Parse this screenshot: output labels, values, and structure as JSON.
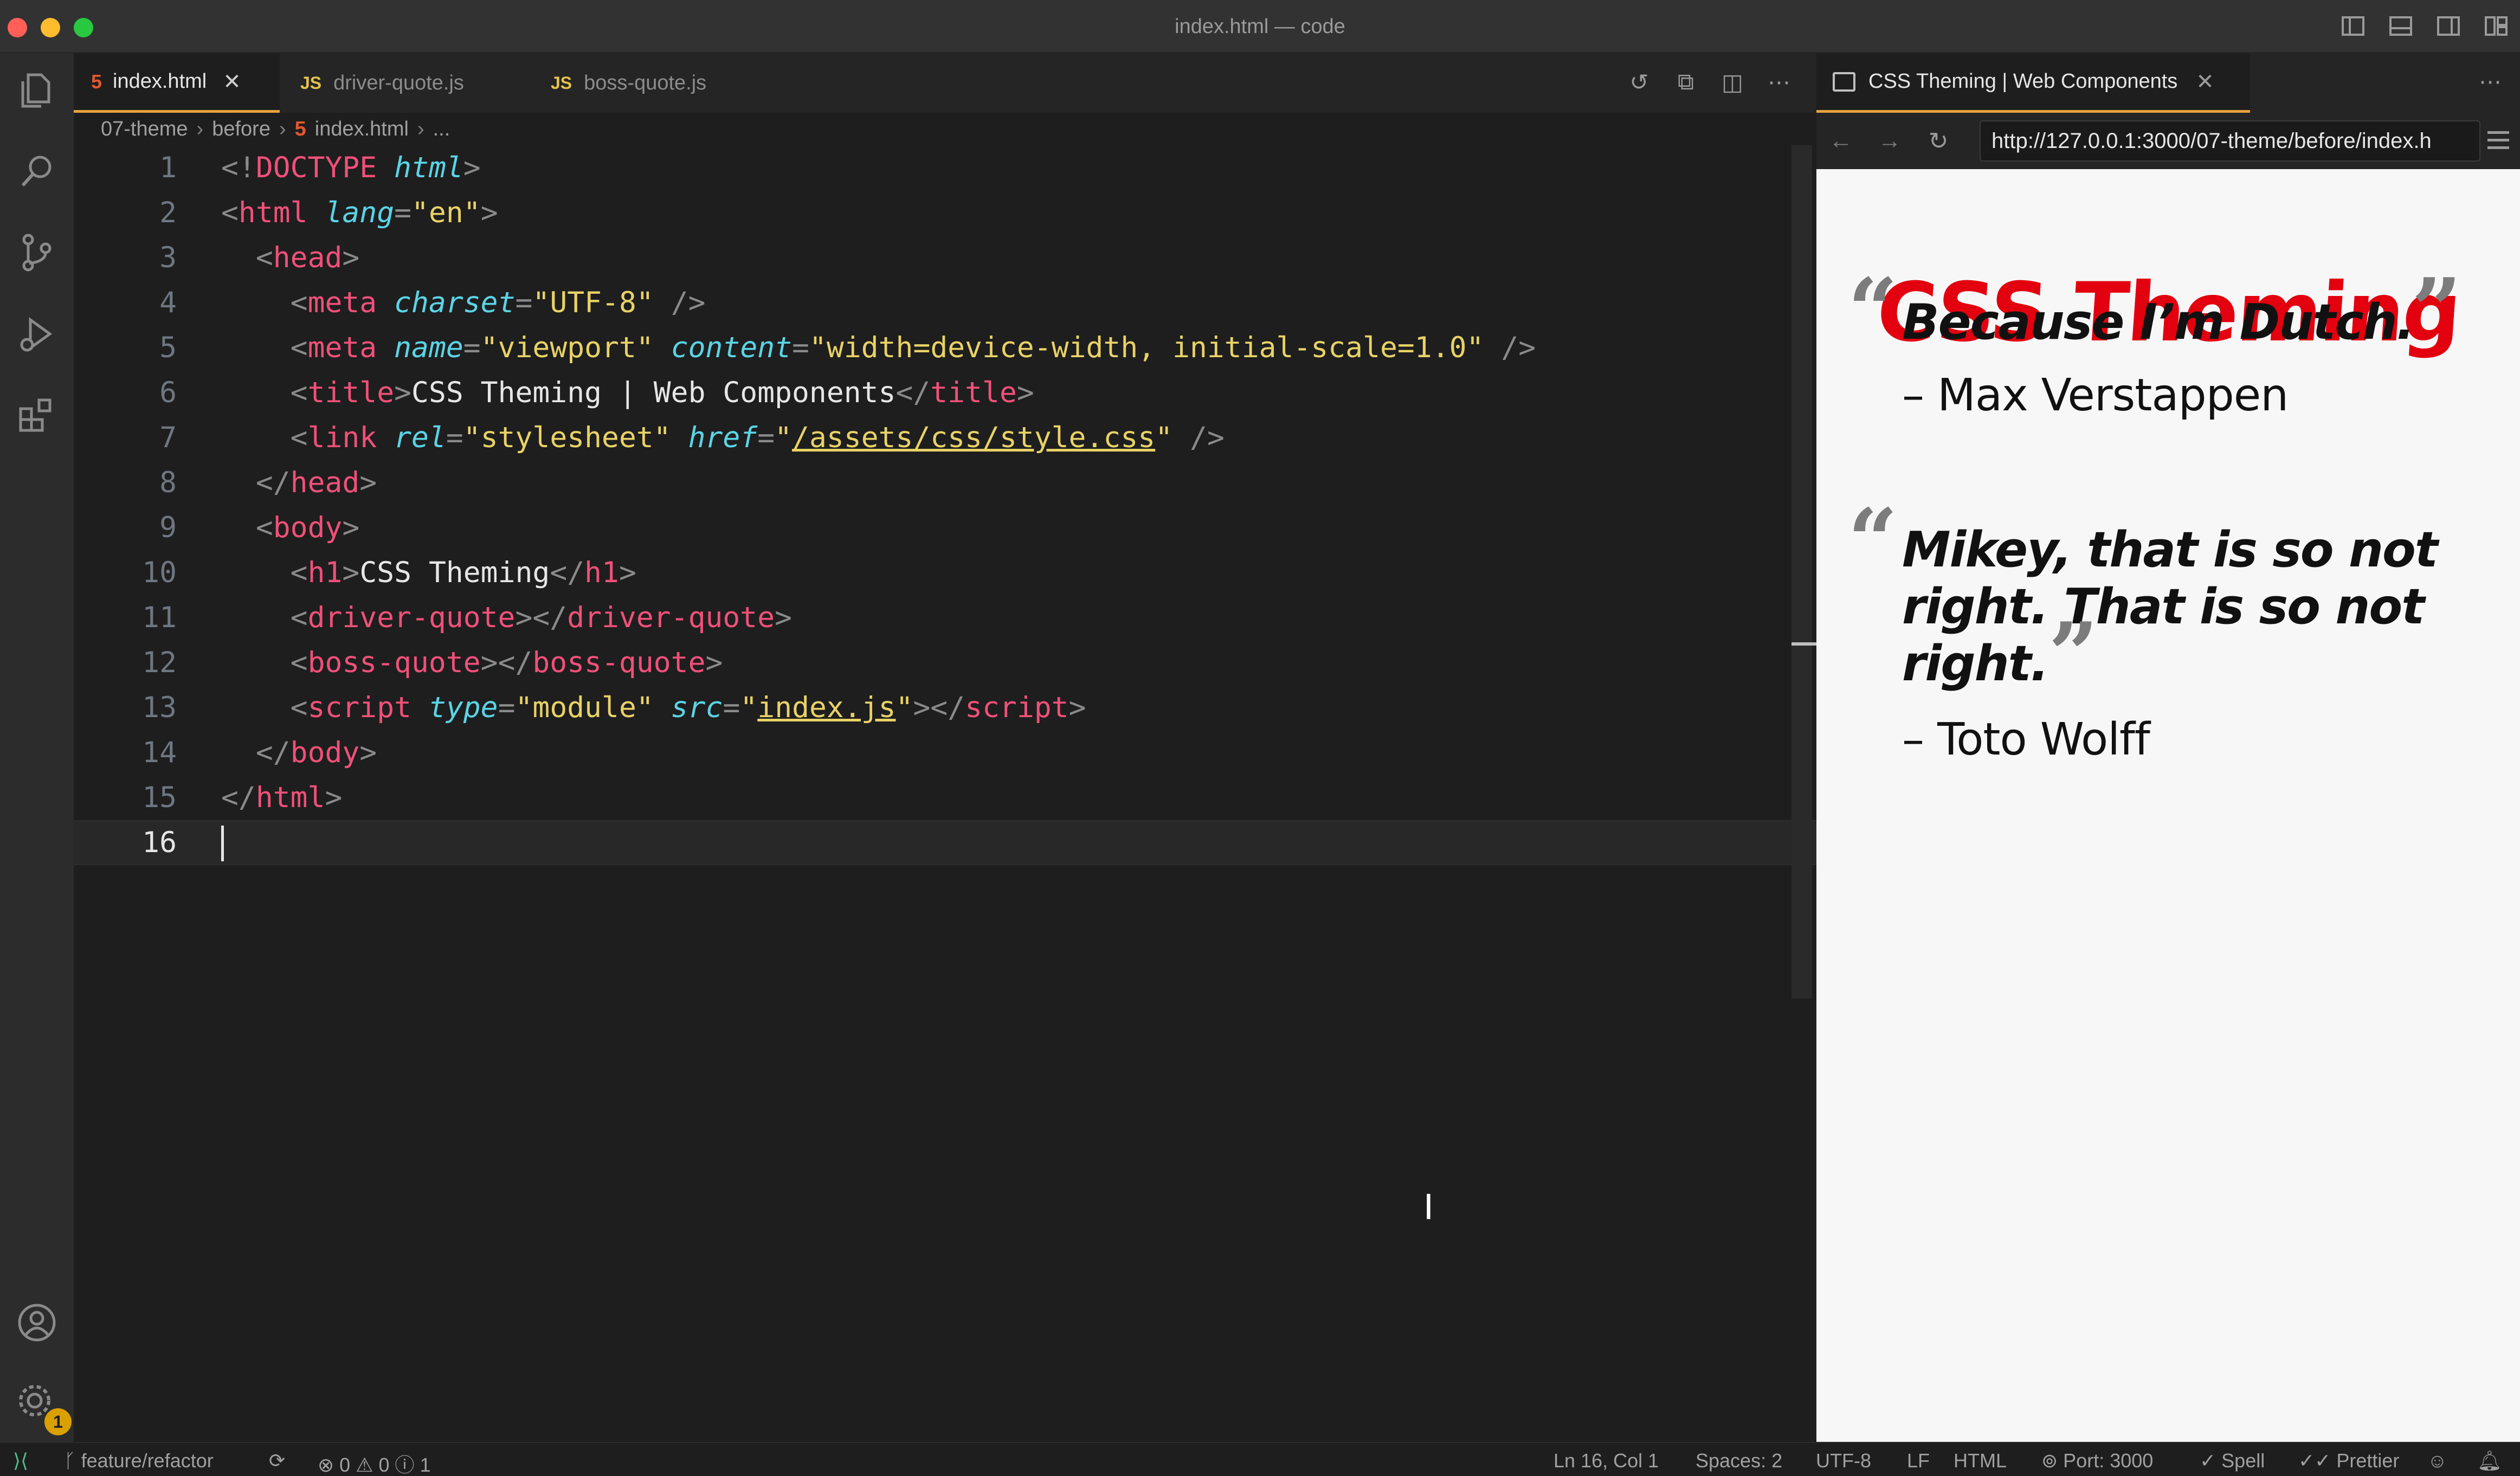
{
  "window": {
    "title": "index.html — code"
  },
  "editor_tabs": [
    {
      "label": "index.html",
      "type": "html",
      "active": true
    },
    {
      "label": "driver-quote.js",
      "type": "js",
      "active": false
    },
    {
      "label": "boss-quote.js",
      "type": "js",
      "active": false
    }
  ],
  "breadcrumb": [
    "07-theme",
    "before",
    "index.html",
    "..."
  ],
  "code": {
    "line_numbers": [
      "1",
      "2",
      "3",
      "4",
      "5",
      "6",
      "7",
      "8",
      "9",
      "10",
      "11",
      "12",
      "13",
      "14",
      "15",
      "16"
    ],
    "tokens": {
      "doctype": "DOCTYPE",
      "doctype_html": "html",
      "html": "html",
      "lang": "lang",
      "lang_val": "\"en\"",
      "head": "head",
      "meta": "meta",
      "charset": "charset",
      "utf8": "\"UTF-8\"",
      "name": "name",
      "viewport": "\"viewport\"",
      "content": "content",
      "content_val": "\"width=device-width, initial-scale=1.0\"",
      "title_tag": "title",
      "title_text": "CSS Theming | Web Components",
      "link": "link",
      "rel": "rel",
      "stylesheet": "\"stylesheet\"",
      "href": "href",
      "href_val": "/assets/css/style.css",
      "body": "body",
      "h1": "h1",
      "h1_text": "CSS Theming",
      "driver_quote": "driver-quote",
      "boss_quote": "boss-quote",
      "script": "script",
      "type": "type",
      "module": "\"module\"",
      "src": "src",
      "src_val": "index.js"
    }
  },
  "browser": {
    "tab_title": "CSS Theming | Web Components",
    "url": "http://127.0.0.1:3000/07-theme/before/index.h",
    "page": {
      "heading": "CSS Theming",
      "quotes": [
        {
          "lines": [
            "Because I’m Dutch."
          ],
          "author": "– Max Verstappen"
        },
        {
          "lines": [
            "Mikey, that is so not",
            "right. That is so not",
            "right."
          ],
          "author": "– Toto Wolff"
        }
      ]
    }
  },
  "status": {
    "branch": "feature/refactor",
    "errors": "0",
    "warnings": "0",
    "info": "1",
    "position": "Ln 16, Col 1",
    "spaces": "Spaces: 2",
    "encoding": "UTF-8",
    "eol": "LF",
    "language": "HTML",
    "port": "Port: 3000",
    "spell": "Spell",
    "prettier": "Prettier"
  },
  "activity": {
    "settings_badge": "1"
  }
}
